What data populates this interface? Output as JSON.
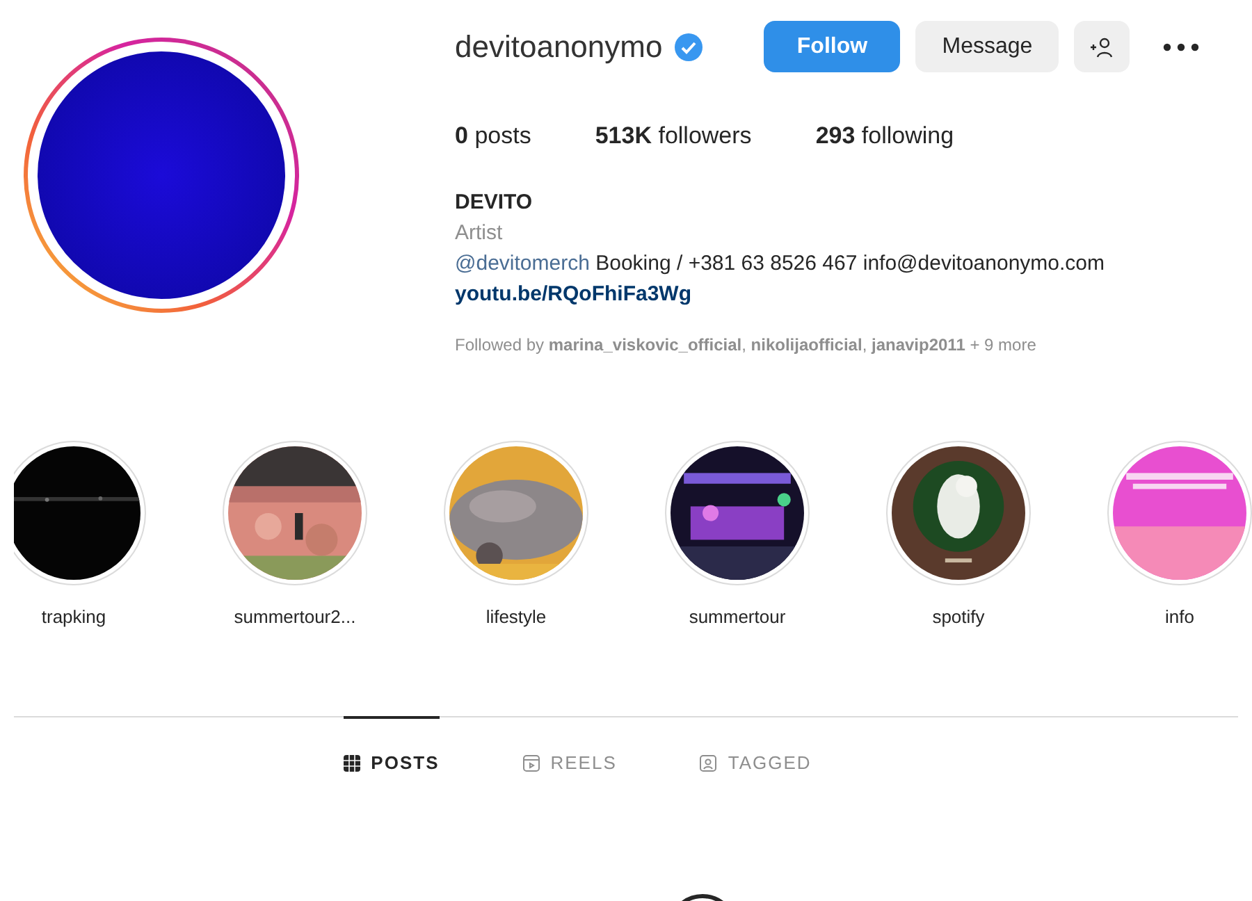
{
  "profile": {
    "username": "devitoanonymo",
    "verified": true,
    "buttons": [
      {
        "label": "Follow",
        "kind": "primary"
      },
      {
        "label": "Message",
        "kind": "secondary"
      }
    ],
    "stats": [
      {
        "count": "0",
        "label": "posts"
      },
      {
        "count": "513K",
        "label": "followers"
      },
      {
        "count": "293",
        "label": "following"
      }
    ],
    "name": "DEVITO",
    "category": "Artist",
    "bio_mention": "@devitomerch",
    "bio_text": "Booking / +381 63 8526 467 info@devitoanonymo.com",
    "link": "youtu.be/RQoFhiFa3Wg",
    "followed_by": "Followed by **marina_viskovic_official**, **nikolijaofficial**, **janavip2011** + 9 more"
  },
  "highlights": [
    {
      "label": "trapking",
      "kind": "picture"
    },
    {
      "label": "summertour2...",
      "kind": "picture"
    },
    {
      "label": "lifestyle",
      "kind": "picture"
    },
    {
      "label": "summertour",
      "kind": "picture"
    },
    {
      "label": "spotify",
      "kind": "picture"
    },
    {
      "label": "info",
      "kind": "picture"
    }
  ],
  "tabs": [
    {
      "label": "POSTS",
      "selected": true
    },
    {
      "label": "REELS",
      "selected": false
    },
    {
      "label": "TAGGED",
      "selected": false
    }
  ]
}
